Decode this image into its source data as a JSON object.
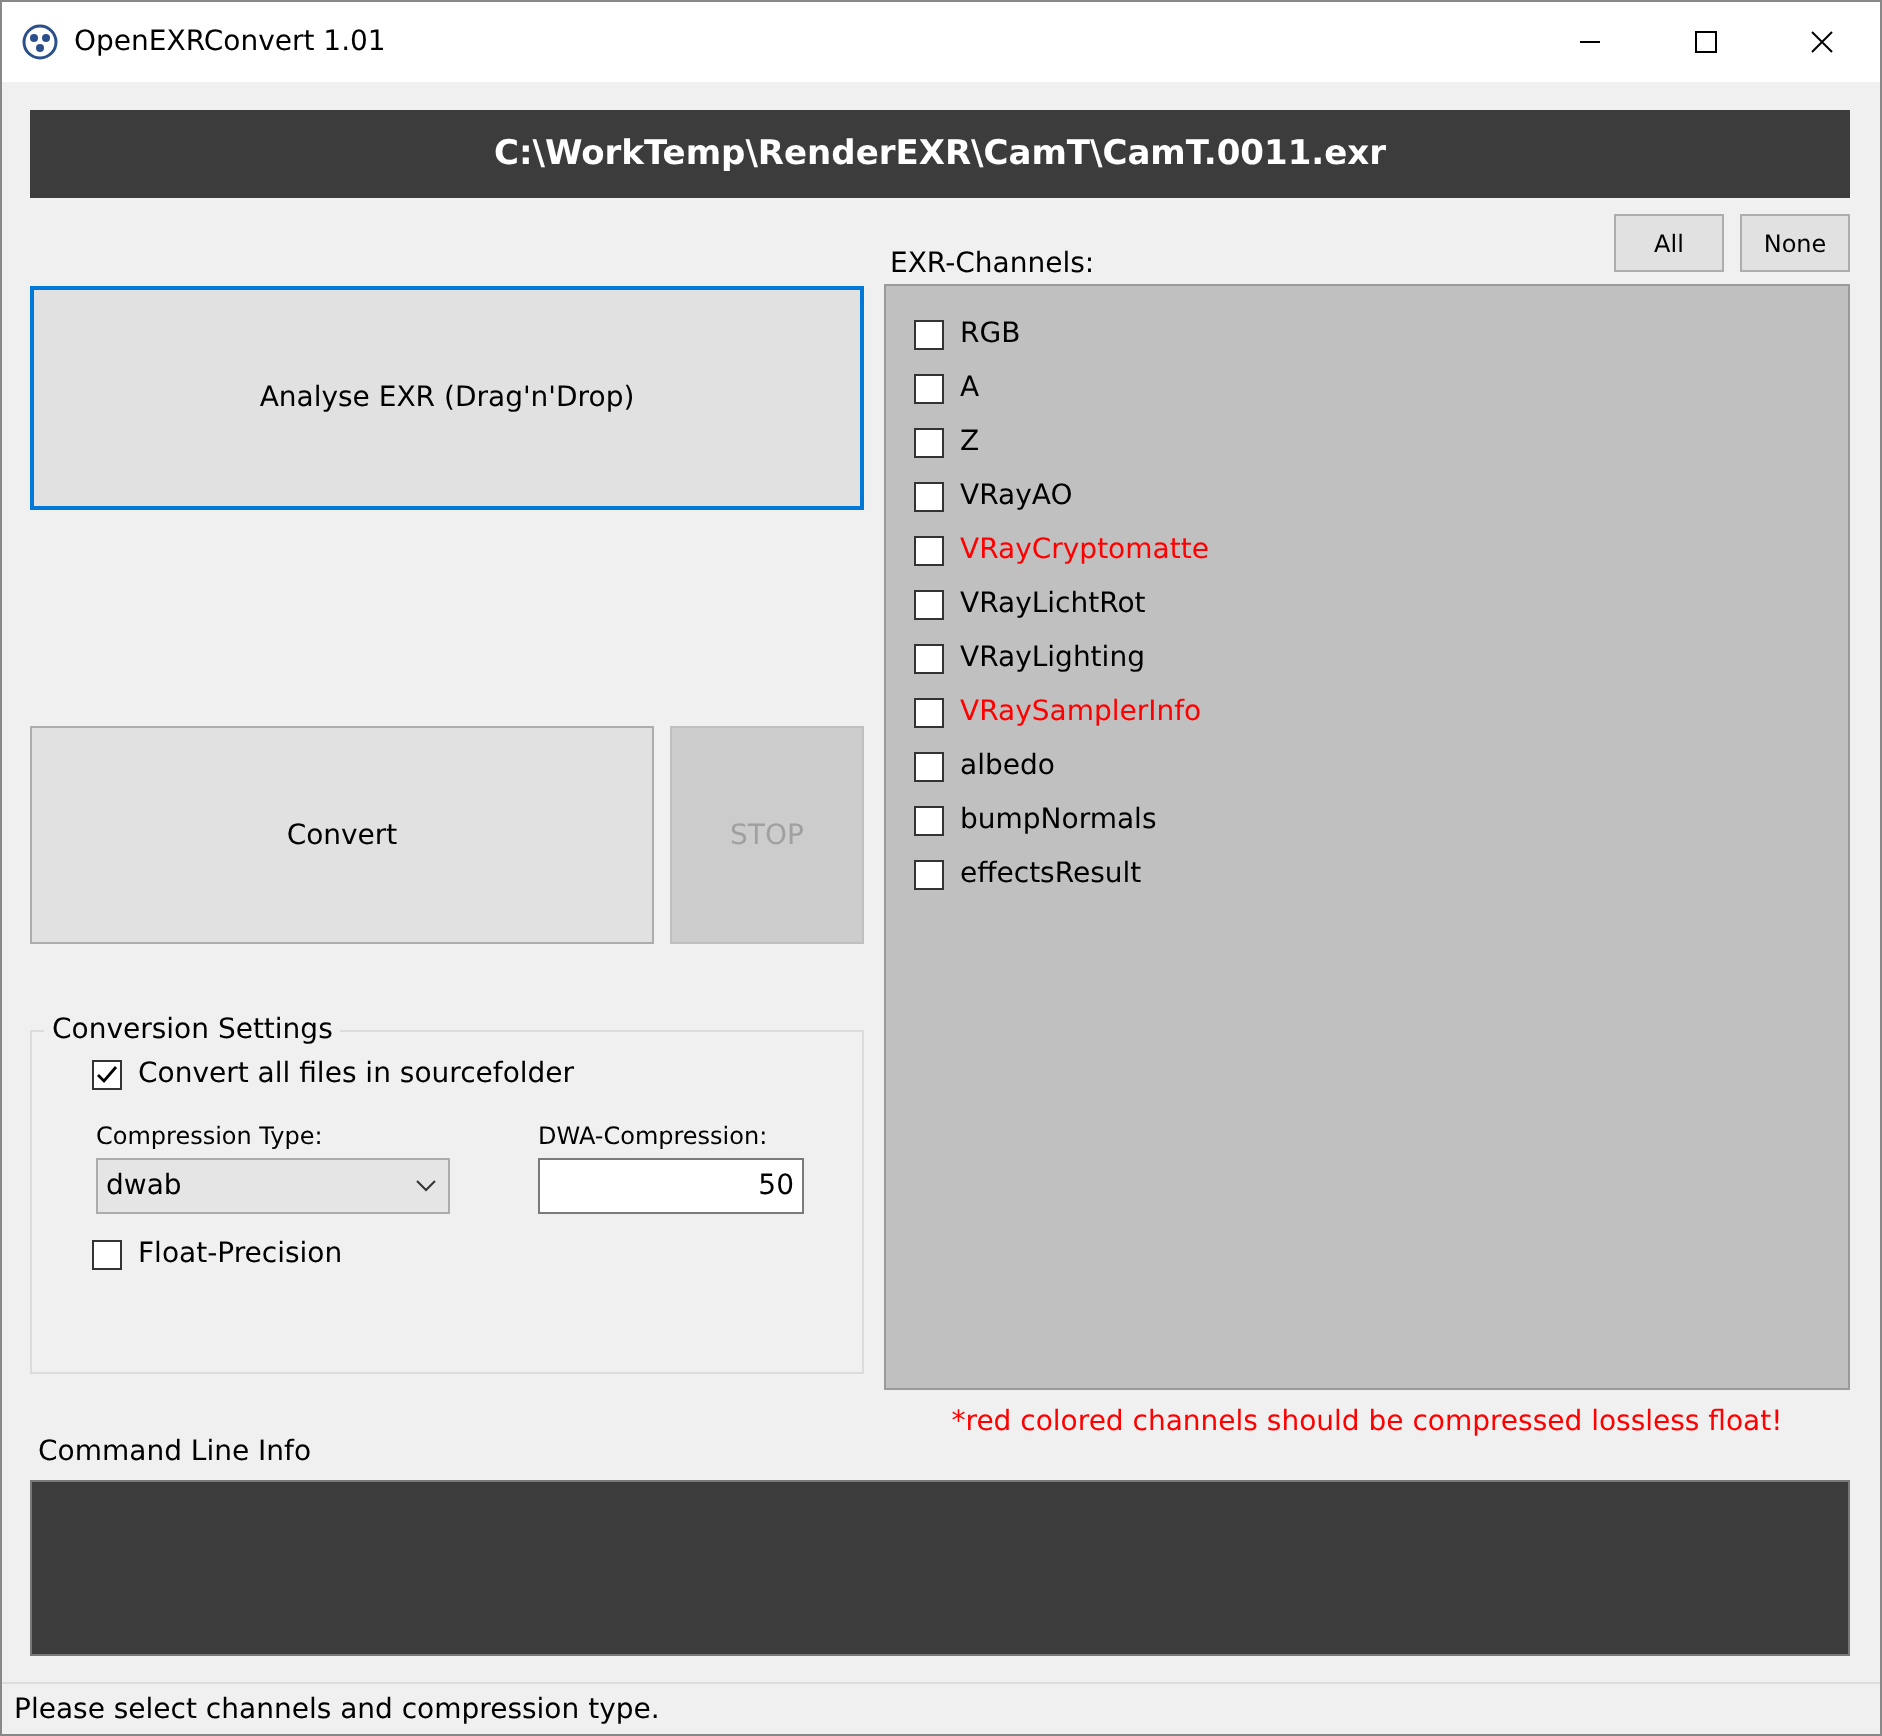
{
  "window": {
    "title": "OpenEXRConvert 1.01"
  },
  "file_path": "C:\\WorkTemp\\RenderEXR\\CamT\\CamT.0011.exr",
  "analyse_button": {
    "label": "Analyse EXR (Drag'n'Drop)",
    "focused": true
  },
  "convert_button": {
    "label": "Convert"
  },
  "stop_button": {
    "label": "STOP",
    "disabled": true
  },
  "conversion_settings": {
    "title": "Conversion Settings",
    "convert_all": {
      "label": "Convert all files in sourcefolder",
      "checked": true
    },
    "compression_type": {
      "label": "Compression Type:",
      "value": "dwab"
    },
    "dwa_compression": {
      "label": "DWA-Compression:",
      "value": "50"
    },
    "float_precision": {
      "label": "Float-Precision",
      "checked": false
    }
  },
  "channels_label": "EXR-Channels:",
  "channel_buttons": [
    "All",
    "None"
  ],
  "channels": [
    {
      "name": "RGB",
      "checked": false,
      "color": "#000000"
    },
    {
      "name": "A",
      "checked": false,
      "color": "#000000"
    },
    {
      "name": "Z",
      "checked": false,
      "color": "#000000"
    },
    {
      "name": "VRayAO",
      "checked": false,
      "color": "#000000"
    },
    {
      "name": "VRayCryptomatte",
      "checked": false,
      "color": "#ff0000"
    },
    {
      "name": "VRayLichtRot",
      "checked": false,
      "color": "#000000"
    },
    {
      "name": "VRayLighting",
      "checked": false,
      "color": "#000000"
    },
    {
      "name": "VRaySamplerInfo",
      "checked": false,
      "color": "#ff0000"
    },
    {
      "name": "albedo",
      "checked": false,
      "color": "#000000"
    },
    {
      "name": "bumpNormals",
      "checked": false,
      "color": "#000000"
    },
    {
      "name": "effectsResult",
      "checked": false,
      "color": "#000000"
    }
  ],
  "note": "*red colored channels should be compressed lossless float!",
  "command_line_label": "Command Line Info",
  "status_bar": "Please select channels and compression type."
}
